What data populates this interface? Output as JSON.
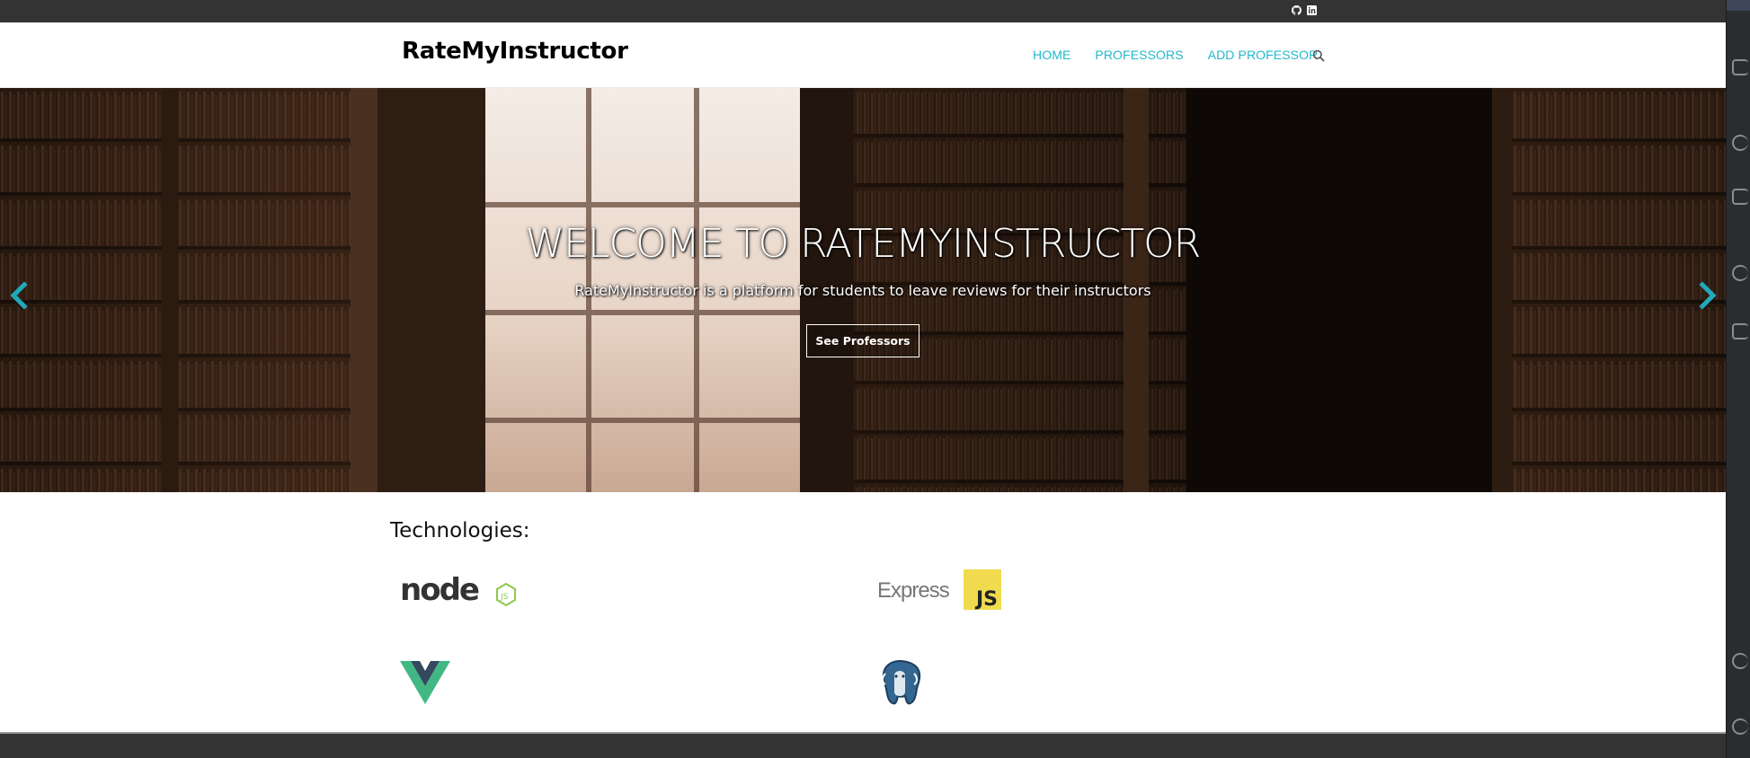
{
  "topbar": {
    "social": [
      {
        "name": "github-icon"
      },
      {
        "name": "linkedin-icon"
      }
    ]
  },
  "navbar": {
    "brand": "RateMyInstructor",
    "links": [
      {
        "label": "HOME"
      },
      {
        "label": "PROFESSORS"
      },
      {
        "label": "ADD PROFESSOR"
      }
    ],
    "search_icon": "search-icon"
  },
  "hero": {
    "title": "WELCOME TO RATEMYINSTRUCTOR",
    "subtitle": "RateMyInstructor is a platform for students to leave reviews for their instructors",
    "button_label": "See Professors",
    "prev_icon": "chevron-left-icon",
    "next_icon": "chevron-right-icon"
  },
  "technologies": {
    "title": "Technologies:",
    "logos": [
      {
        "name": "nodejs-logo",
        "text": "node",
        "badge": "JS"
      },
      {
        "name": "express-logo",
        "text": "Express",
        "badge": "JS"
      },
      {
        "name": "vue-logo"
      },
      {
        "name": "postgresql-logo"
      }
    ]
  },
  "colors": {
    "accent": "#21b8cb",
    "topbar": "#333333",
    "footer": "#333333",
    "node_green": "#8cc84b",
    "js_yellow": "#f0db4f",
    "vue_green": "#41b883",
    "vue_dark": "#35495e",
    "pg_blue": "#336791"
  }
}
